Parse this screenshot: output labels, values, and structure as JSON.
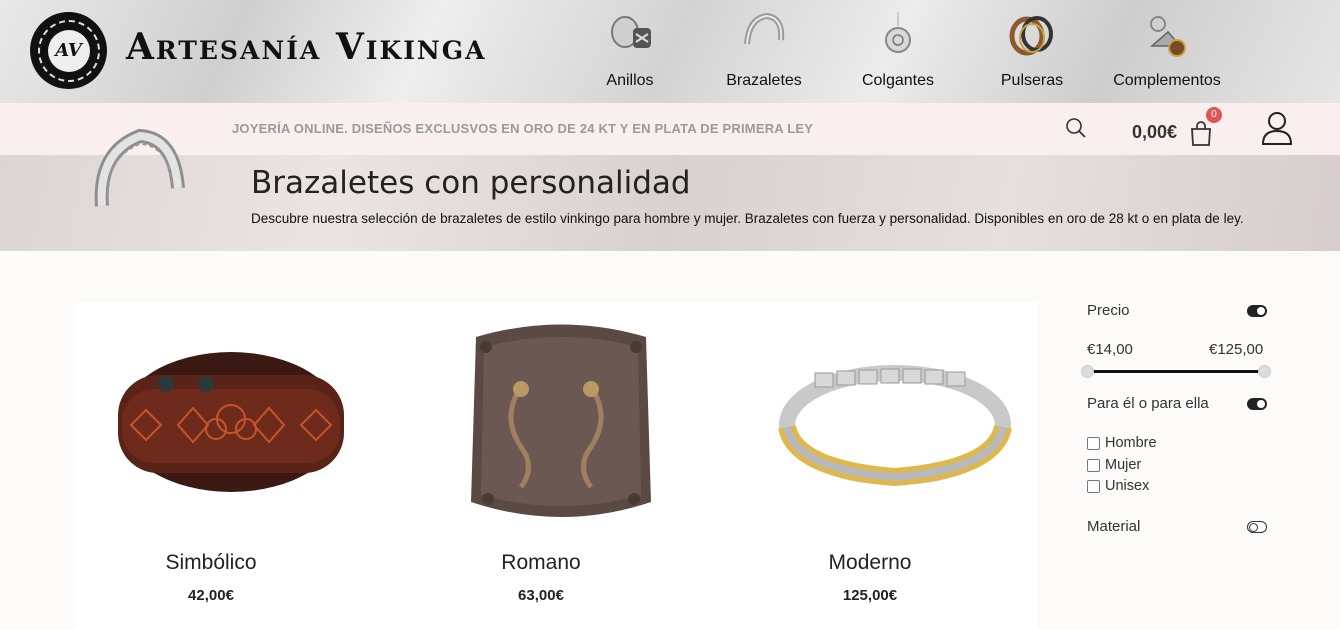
{
  "header": {
    "logo_letters": "AV",
    "brand": "Artesanía Vikinga",
    "nav": [
      {
        "label": "Anillos",
        "icon": "ring-icon"
      },
      {
        "label": "Brazaletes",
        "icon": "bracelet-icon"
      },
      {
        "label": "Colgantes",
        "icon": "pendant-icon"
      },
      {
        "label": "Pulseras",
        "icon": "wristband-icon"
      },
      {
        "label": "Complementos",
        "icon": "accessory-icon"
      }
    ]
  },
  "promo": {
    "text": "JOYERÍA ONLINE. DISEÑOS EXCLUSVOS EN ORO DE 24 KT Y EN PLATA DE PRIMERA LEY",
    "cart_total": "0,00€",
    "cart_count": "0"
  },
  "banner": {
    "title": "Brazaletes con personalidad",
    "description": "Descubre nuestra selección de brazaletes de estilo vinkingo para hombre y mujer. Brazaletes con fuerza y personalidad. Disponibles en oro de 28 kt o en plata de ley."
  },
  "products": [
    {
      "name": "Simbólico",
      "price": "42,00€"
    },
    {
      "name": "Romano",
      "price": "63,00€"
    },
    {
      "name": "Moderno",
      "price": "125,00€"
    }
  ],
  "filters": {
    "price": {
      "label": "Precio",
      "min": "€14,00",
      "max": "€125,00",
      "enabled": true
    },
    "gender": {
      "label": "Para él o para ella",
      "enabled": true,
      "options": [
        "Hombre",
        "Mujer",
        "Unisex"
      ]
    },
    "material": {
      "label": "Material",
      "enabled": false
    }
  },
  "colors": {
    "accent": "#111111",
    "badge": "#e25353",
    "promo_bg": "#f8efee"
  }
}
